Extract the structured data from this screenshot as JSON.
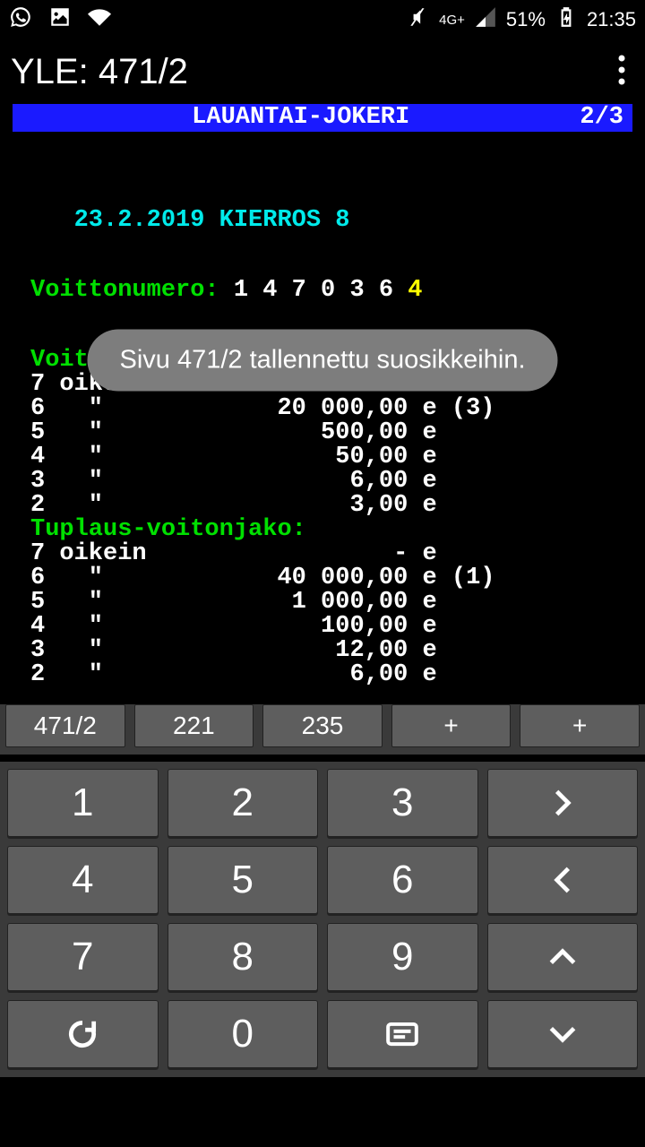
{
  "status": {
    "network": "4G+",
    "battery": "51%",
    "time": "21:35"
  },
  "app": {
    "title": "YLE: 471/2"
  },
  "teletext": {
    "header_title": "LAUANTAI-JOKERI",
    "header_page": "2/3",
    "date_line": "23.2.2019 KIERROS 8",
    "winnum_label": "Voittonumero:",
    "winnum_digits": "1 4 7 0 3 6",
    "winnum_last": " 4",
    "voitonjako_label": "Voitonjako:",
    "v_rows": [
      "7 oikein                 - e",
      "6   \"            20 000,00 e (3)",
      "5   \"               500,00 e",
      "4   \"                50,00 e",
      "3   \"                 6,00 e",
      "2   \"                 3,00 e"
    ],
    "tuplaus_label": "Tuplaus-voitonjako:",
    "t_rows": [
      "7 oikein                 - e",
      "6   \"            40 000,00 e (1)",
      "5   \"             1 000,00 e",
      "4   \"               100,00 e",
      "3   \"                12,00 e",
      "2   \"                 6,00 e"
    ]
  },
  "toast": {
    "message": "Sivu 471/2 tallennettu suosikkeihin."
  },
  "favorites": [
    "471/2",
    "221",
    "235",
    "+",
    "+"
  ],
  "keypad": {
    "k1": "1",
    "k2": "2",
    "k3": "3",
    "k4": "4",
    "k5": "5",
    "k6": "6",
    "k7": "7",
    "k8": "8",
    "k9": "9",
    "k0": "0"
  }
}
